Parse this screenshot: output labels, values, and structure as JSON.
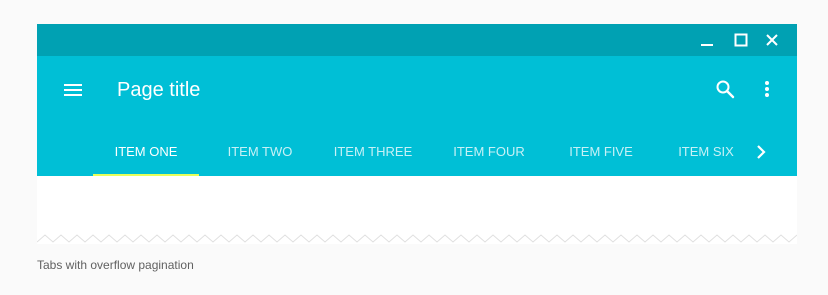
{
  "window": {
    "controls": [
      "minimize-icon",
      "maximize-icon",
      "close-icon"
    ]
  },
  "appbar": {
    "menu_icon": "menu-icon",
    "title": "Page title",
    "actions": [
      "search-icon",
      "more-vert-icon"
    ],
    "color": "#00bfd6",
    "titlebar_color": "#00a1b3"
  },
  "tabs": {
    "items": [
      {
        "label": "ITEM ONE",
        "active": true
      },
      {
        "label": "ITEM TWO",
        "active": false
      },
      {
        "label": "ITEM THREE",
        "active": false
      },
      {
        "label": "ITEM FOUR",
        "active": false
      },
      {
        "label": "ITEM FIVE",
        "active": false
      },
      {
        "label": "ITEM SIX",
        "active": false
      }
    ],
    "indicator_color": "#e6ff5a",
    "overflow_icon": "chevron-right-icon"
  },
  "caption": "Tabs with overflow pagination"
}
